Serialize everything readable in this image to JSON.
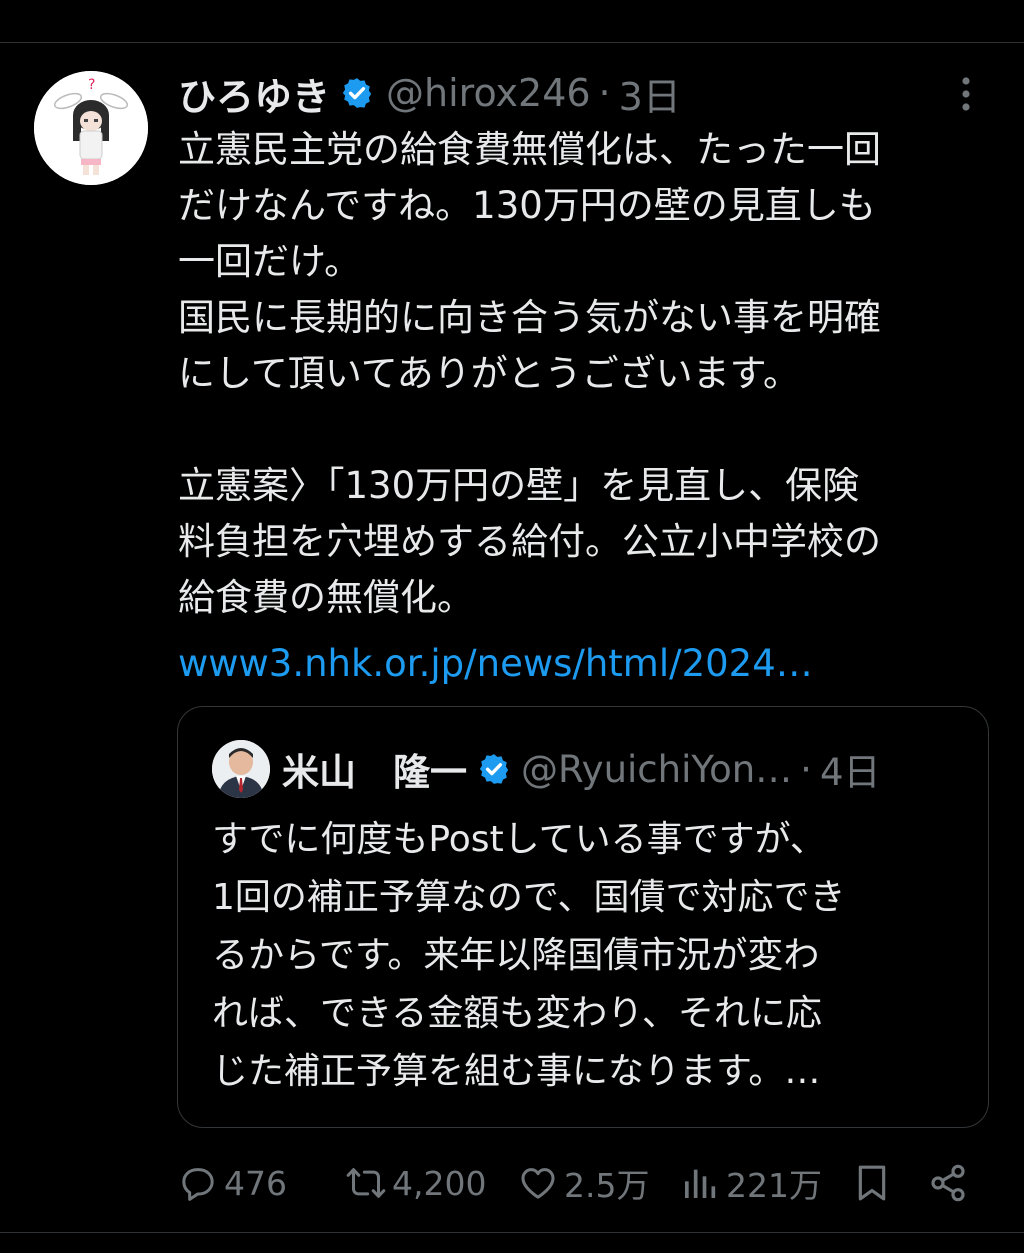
{
  "tweet": {
    "author": {
      "name": "ひろゆき",
      "handle": "@hirox246",
      "time": "3日"
    },
    "text": "立憲民主党の給食費無償化は、たった一回\nだけなんですね。130万円の壁の見直しも\n一回だけ。\n国民に長期的に向き合う気がない事を明確\nにして頂いてありがとうございます。\n\n立憲案〉「130万円の壁」を見直し、保険\n料負担を穴埋めする給付。公立小中学校の\n給食費の無償化。",
    "link": "www3.nhk.or.jp/news/html/2024…"
  },
  "quote": {
    "name": "米山　隆一",
    "handle": "@RyuichiYon…",
    "time": "4日",
    "text": "すでに何度もPostしている事ですが、\n1回の補正予算なので、国債で対応でき\nるからです。来年以降国債市況が変わ\nれば、できる金額も変わり、それに応\nじた補正予算を組む事になります。…"
  },
  "actions": {
    "replies": "476",
    "reposts": "4,200",
    "likes": "2.5万",
    "views": "221万"
  },
  "colors": {
    "background": "#000000",
    "text": "#e7e9ea",
    "secondary": "#71767b",
    "link": "#1d9bf0",
    "verified": "#1d9bf0",
    "border": "#2f3336"
  }
}
